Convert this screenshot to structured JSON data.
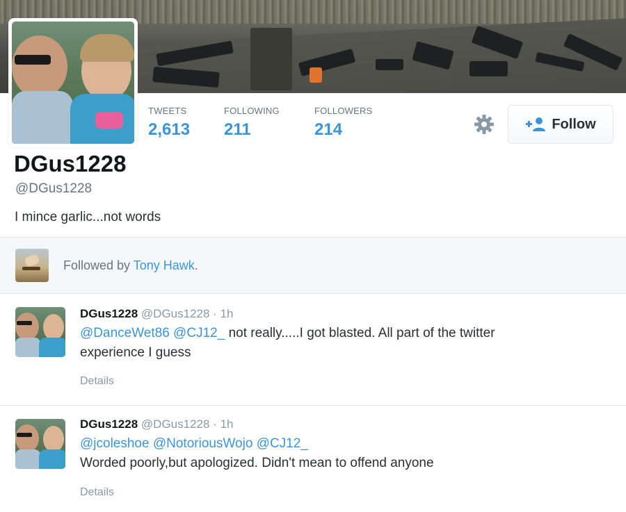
{
  "profile": {
    "display_name": "DGus1228",
    "handle": "@DGus1228",
    "bio": "I mince garlic...not words"
  },
  "stats": [
    {
      "label": "TWEETS",
      "value": "2,613"
    },
    {
      "label": "FOLLOWING",
      "value": "211"
    },
    {
      "label": "FOLLOWERS",
      "value": "214"
    }
  ],
  "actions": {
    "follow_label": "Follow",
    "settings_icon": "gear-icon",
    "follow_icon": "add-user-icon"
  },
  "followed_by": {
    "prefix": "Followed by",
    "name": "Tony Hawk",
    "suffix": "."
  },
  "tweets": [
    {
      "fullname": "DGus1228",
      "username": "@DGus1228",
      "separator": "·",
      "time": "1h",
      "mentions": "@DanceWet86 @CJ12_",
      "text_line1": "not really.....I got blasted. All part of the twitter",
      "text_line2": "experience I guess",
      "details": "Details"
    },
    {
      "fullname": "DGus1228",
      "username": "@DGus1228",
      "separator": "·",
      "time": "1h",
      "mentions": "@jcoleshoe @NotoriousWojo @CJ12_",
      "text_line2": "Worded poorly,but apologized. Didn't mean to offend anyone",
      "details": "Details"
    }
  ],
  "colors": {
    "link_blue": "#3b94d9",
    "muted_gray": "#66757f",
    "border": "#e1e8ed"
  }
}
